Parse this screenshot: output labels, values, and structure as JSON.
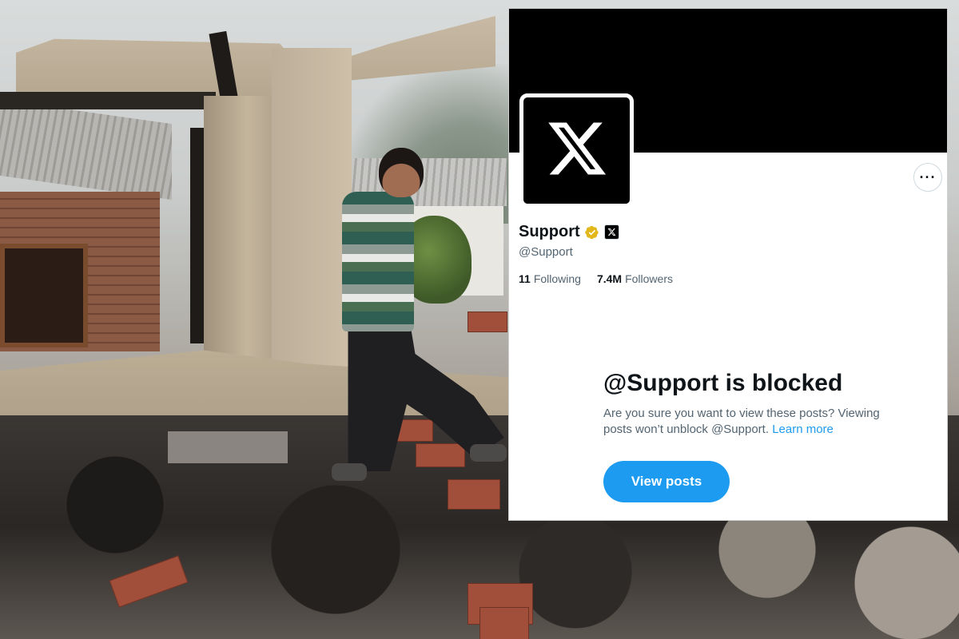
{
  "profile": {
    "display_name": "Support",
    "handle": "@Support",
    "following_count": "11",
    "following_label": "Following",
    "followers_count": "7.4M",
    "followers_label": "Followers",
    "verified_badge_icon": "verified-gold-badge-icon",
    "affiliate_icon": "x-logo-icon",
    "avatar_icon": "x-logo-icon",
    "more_icon": "more-options-icon",
    "more_label": "···"
  },
  "blocked": {
    "title": "@Support is blocked",
    "message": "Are you sure you want to view these posts? Viewing posts won’t unblock @Support.",
    "learn_more": "Learn more",
    "button_label": "View posts"
  },
  "colors": {
    "accent": "#1d9bf0",
    "banner": "#000000",
    "gold_badge": "#e2b719",
    "secondary_text": "#536471"
  }
}
